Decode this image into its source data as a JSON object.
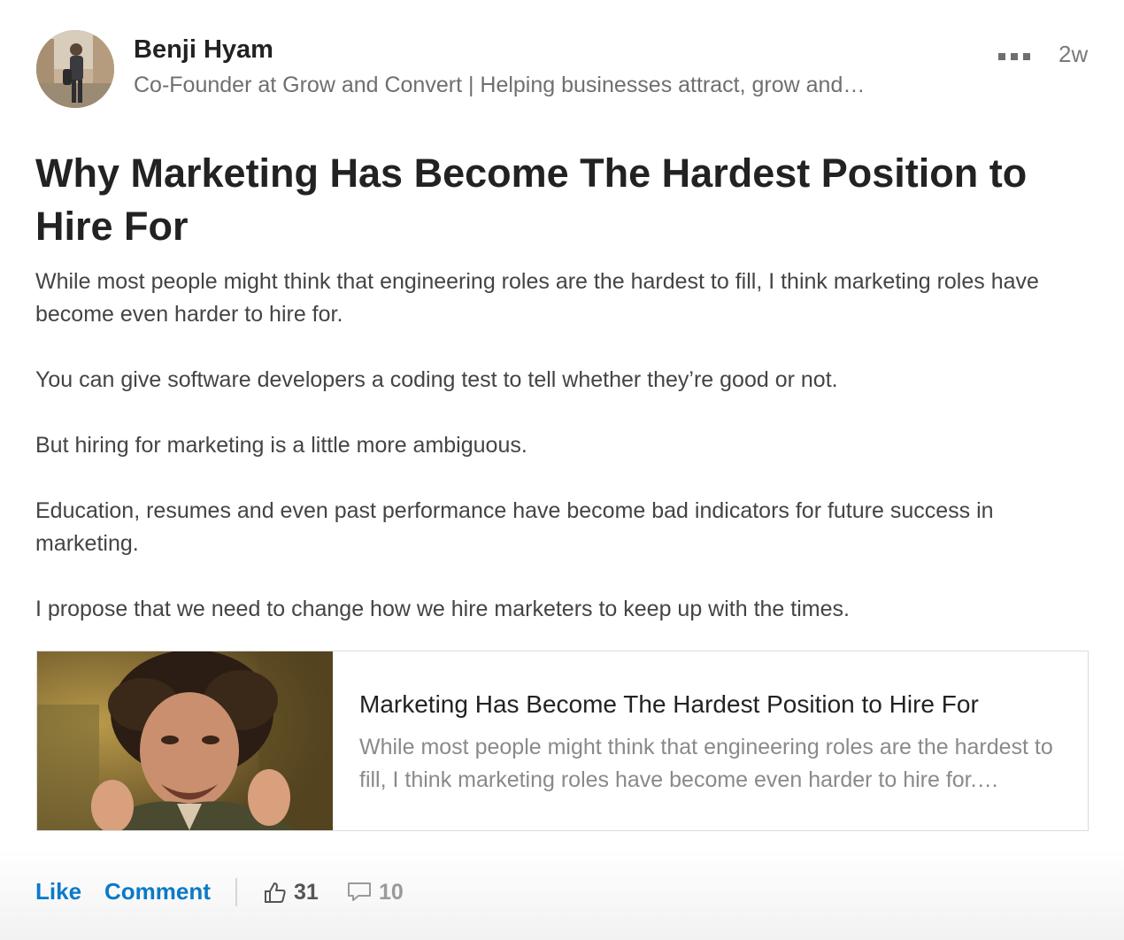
{
  "author": {
    "name": "Benji Hyam",
    "headline": "Co-Founder at Grow and Convert | Helping businesses attract, grow and…"
  },
  "post": {
    "age": "2w",
    "title": "Why Marketing Has Become The Hardest Position to Hire For",
    "paragraphs": [
      "While most people might think that engineering roles are the hardest to fill, I think marketing roles have become even harder to hire for.",
      "You can give software developers a coding test to tell whether they’re good or not.",
      "But hiring for marketing is a little more ambiguous.",
      "Education, resumes and even past performance have become bad indicators for future success in marketing.",
      "I propose that we need to change how we hire marketers to keep up with the times."
    ]
  },
  "link_card": {
    "title": "Marketing Has Become The Hardest Position to Hire For",
    "description": "While most people might think that engineering roles are the hardest to fill, I think marketing roles have become even harder to hire for.…"
  },
  "actions": {
    "like_label": "Like",
    "comment_label": "Comment"
  },
  "stats": {
    "likes": "31",
    "comments": "10"
  },
  "icons": {
    "more": "more-dots-icon",
    "likes": "thumbs-up-icon",
    "comments": "comment-bubble-icon"
  },
  "colors": {
    "action_blue": "#0a7ac9",
    "likes_count": "#555555",
    "comments_count": "#9a9a9a"
  }
}
